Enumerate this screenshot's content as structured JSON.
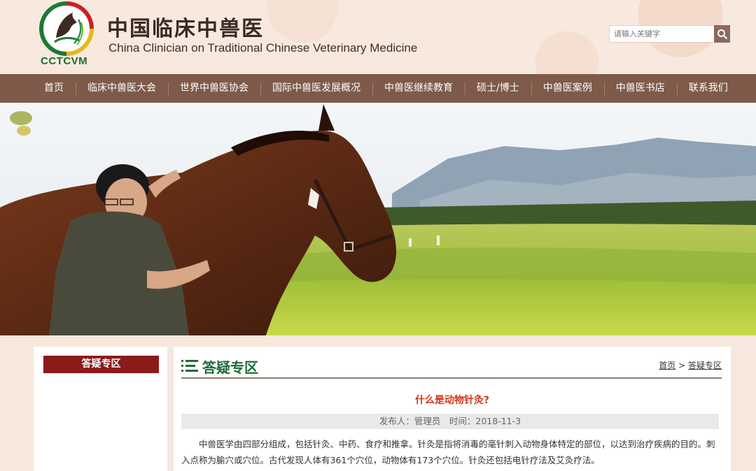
{
  "header": {
    "logo_abbr": "CCTCVM",
    "title_cn": "中国临床中兽医",
    "title_en": "China Clinician on Traditional Chinese Veterinary Medicine",
    "search_placeholder": "请输入关键字",
    "search_icon": "search-icon"
  },
  "nav": {
    "items": [
      {
        "label": "首页"
      },
      {
        "label": "临床中兽医大会"
      },
      {
        "label": "世界中兽医协会"
      },
      {
        "label": "国际中兽医发展概况"
      },
      {
        "label": "中兽医继续教育"
      },
      {
        "label": "硕士/博士"
      },
      {
        "label": "中兽医案例"
      },
      {
        "label": "中兽医书店"
      },
      {
        "label": "联系我们"
      }
    ]
  },
  "sidebar": {
    "title": "答疑专区"
  },
  "main": {
    "section_title": "答疑专区",
    "breadcrumb": {
      "home": "首页",
      "separator": ">",
      "current": "答疑专区"
    },
    "article": {
      "title": "什么是动物针灸?",
      "meta": "发布人：管理员　时间：2018-11-3",
      "body": "中兽医学由四部分组成，包括针灸、中药、食疗和推拿。针灸是指将消毒的毫针刺入动物身体特定的部位，以达到治疗疾病的目的。刺入点称为腧穴或穴位。古代发现人体有361个穴位，动物体有173个穴位。针灸还包括电针疗法及艾灸疗法。"
    }
  },
  "colors": {
    "nav_bg": "#7e5a4a",
    "sidebar_title_bg": "#8b1a1a",
    "section_title": "#1f6a3a",
    "article_title": "#d4351c"
  }
}
